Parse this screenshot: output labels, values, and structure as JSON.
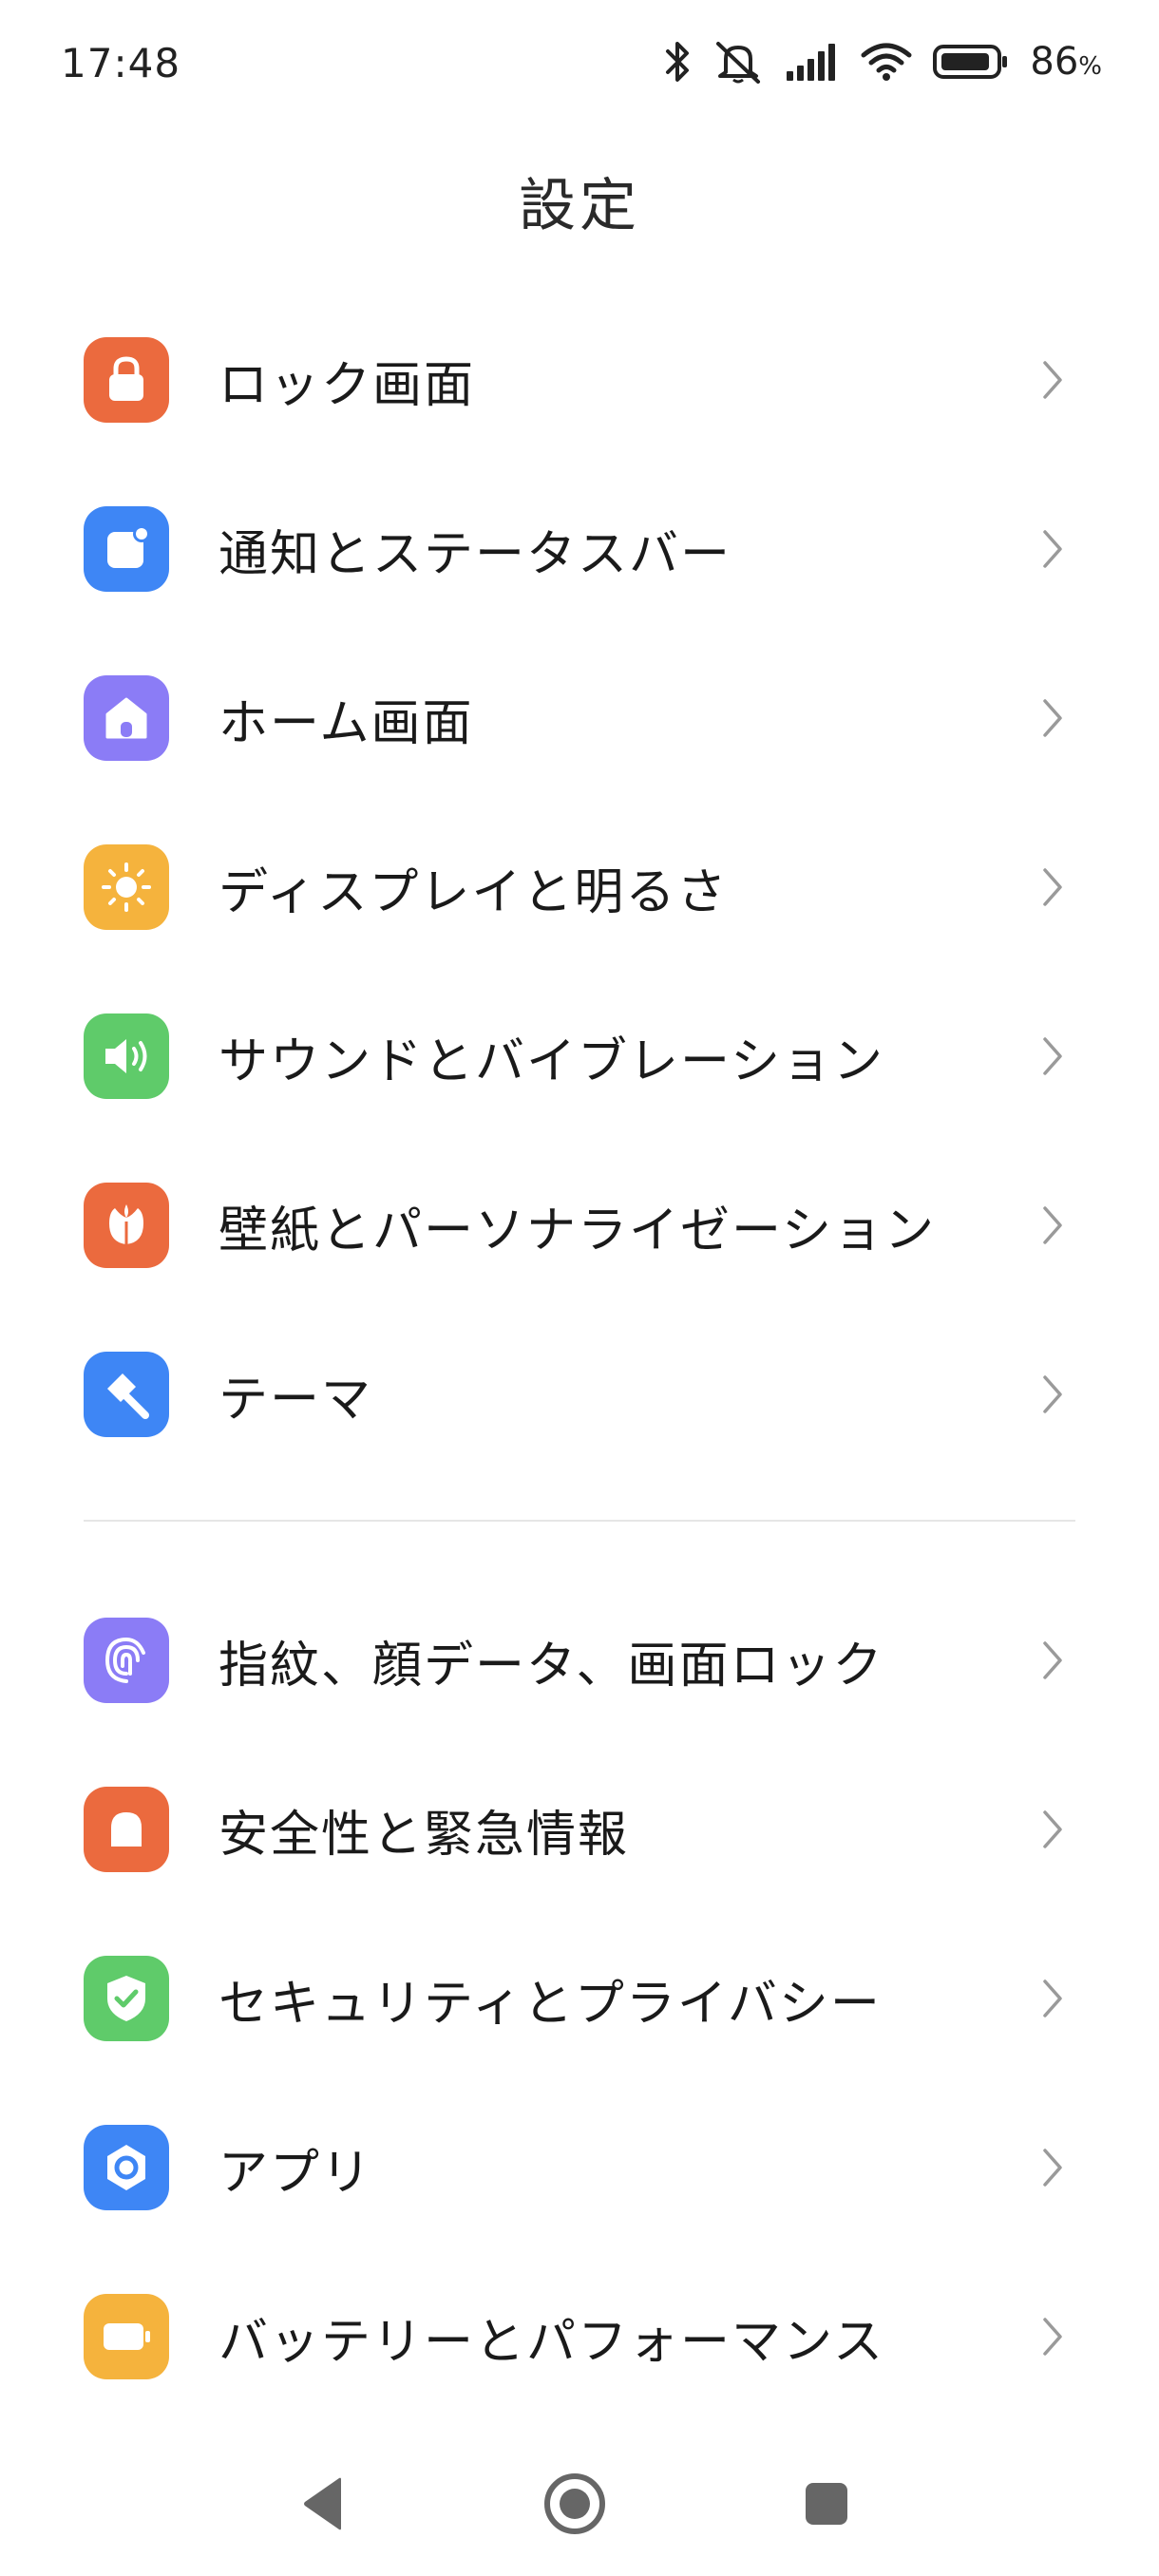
{
  "status_bar": {
    "time": "17:48",
    "battery_percent": "86",
    "battery_percent_sign": "%",
    "icons": [
      "bluetooth-icon",
      "muted-bell-icon",
      "signal-icon",
      "wifi-icon",
      "battery-icon"
    ]
  },
  "header": {
    "title": "設定"
  },
  "groups": [
    {
      "items": [
        {
          "label": "ロック画面",
          "icon": "lock-icon",
          "color": "#EB6A3E"
        },
        {
          "label": "通知とステータスバー",
          "icon": "notification-icon",
          "color": "#3E86F5"
        },
        {
          "label": "ホーム画面",
          "icon": "home-icon",
          "color": "#8B7CF6"
        },
        {
          "label": "ディスプレイと明るさ",
          "icon": "sun-icon",
          "color": "#F5B33D"
        },
        {
          "label": "サウンドとバイブレーション",
          "icon": "speaker-icon",
          "color": "#5FCB6A"
        },
        {
          "label": "壁紙とパーソナライゼーション",
          "icon": "flower-icon",
          "color": "#EB6A3E"
        },
        {
          "label": "テーマ",
          "icon": "paint-brush-icon",
          "color": "#3E86F5"
        }
      ]
    },
    {
      "items": [
        {
          "label": "指紋、顔データ、画面ロック",
          "icon": "fingerprint-icon",
          "color": "#8B7CF6"
        },
        {
          "label": "安全性と緊急情報",
          "icon": "emergency-light-icon",
          "color": "#EB6A3E"
        },
        {
          "label": "セキュリティとプライバシー",
          "icon": "shield-check-icon",
          "color": "#5FCB6A"
        },
        {
          "label": "アプリ",
          "icon": "app-hexagon-icon",
          "color": "#3E86F5"
        },
        {
          "label": "バッテリーとパフォーマンス",
          "icon": "battery-icon",
          "color": "#F5B33D"
        }
      ]
    }
  ],
  "nav_bar": {
    "buttons": [
      "back-icon",
      "home-circle-icon",
      "recents-icon"
    ]
  }
}
